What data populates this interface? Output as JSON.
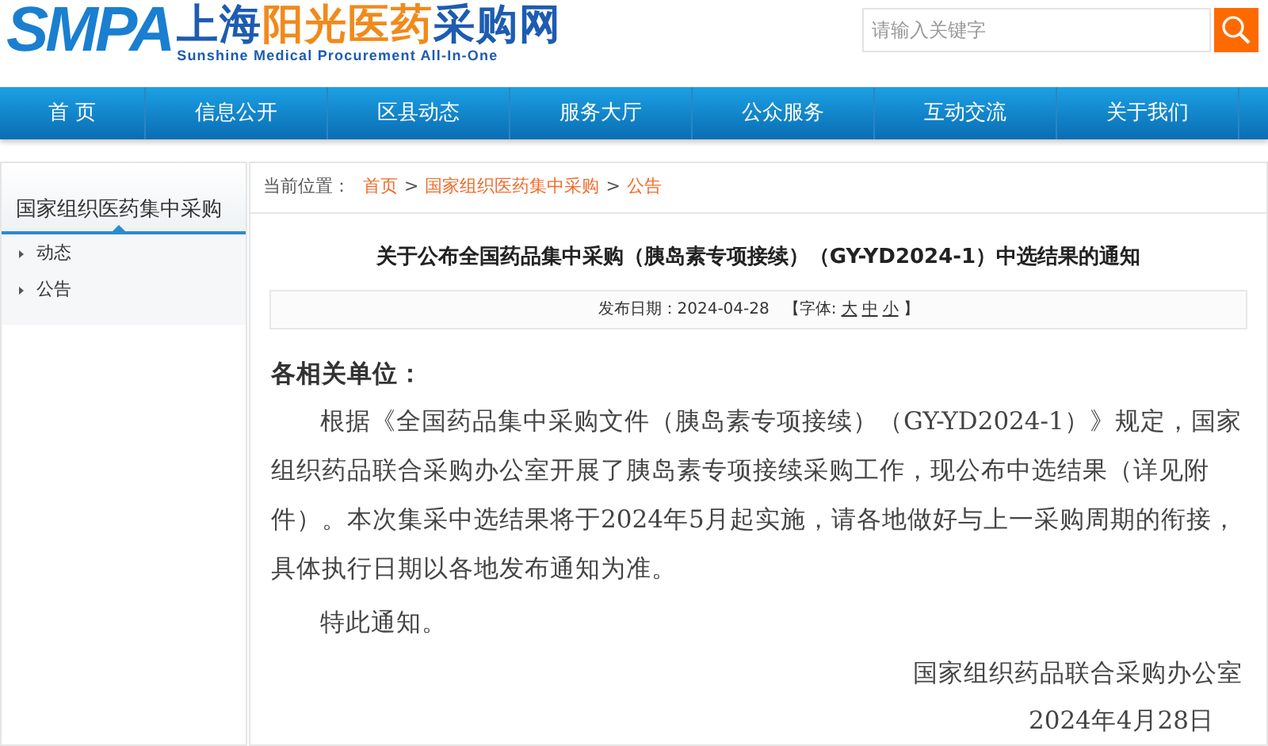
{
  "logo": {
    "mark": "SMPA",
    "title_parts": [
      {
        "text": "上海",
        "color": "#1d5cb0"
      },
      {
        "text": "阳光医药",
        "color": "#f08a1c"
      },
      {
        "text": "采购网",
        "color": "#1d5cb0"
      }
    ],
    "subtitle": "Sunshine Medical Procurement All-In-One"
  },
  "search": {
    "placeholder": "请输入关键字"
  },
  "nav": [
    "首 页",
    "信息公开",
    "区县动态",
    "服务大厅",
    "公众服务",
    "互动交流",
    "关于我们"
  ],
  "sidebar": {
    "title": "国家组织医药集中采购",
    "items": [
      "动态",
      "公告"
    ]
  },
  "breadcrumb": {
    "label": "当前位置：",
    "links": [
      "首页",
      "国家组织医药集中采购",
      "公告"
    ],
    "separator": ">"
  },
  "article": {
    "title": "关于公布全国药品集中采购（胰岛素专项接续）（GY-YD2024-1）中选结果的通知",
    "meta": {
      "date_label": "发布日期：",
      "date": "2024-04-28",
      "font_label": "【字体:",
      "font_sizes": [
        "大",
        "中",
        "小"
      ],
      "font_end": "】"
    },
    "salutation": "各相关单位：",
    "paragraphs": [
      "根据《全国药品集中采购文件（胰岛素专项接续）（GY-YD2024-1）》规定，国家组织药品联合采购办公室开展了胰岛素专项接续采购工作，现公布中选结果（详见附件）。本次集采中选结果将于2024年5月起实施，请各地做好与上一采购周期的衔接，具体执行日期以各地发布通知为准。",
      "特此通知。"
    ],
    "signature": "国家组织药品联合采购办公室",
    "signed_date": "2024年4月28日"
  }
}
